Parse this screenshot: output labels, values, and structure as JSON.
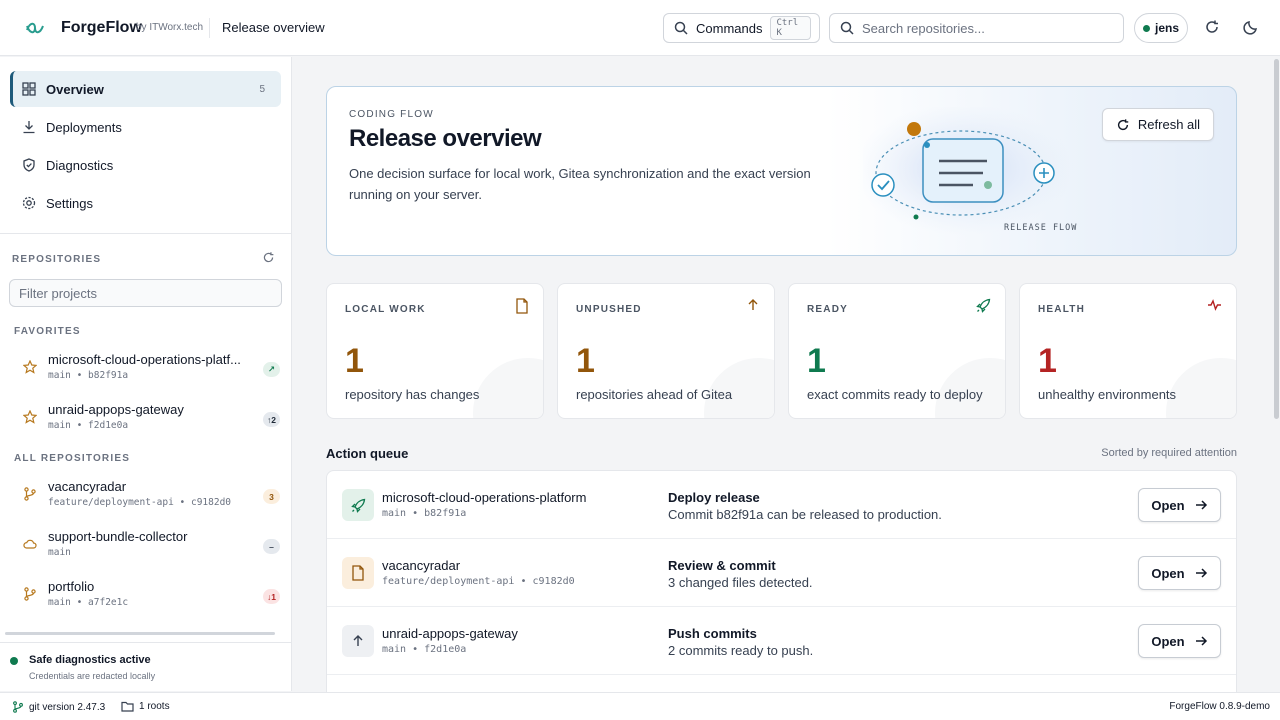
{
  "header": {
    "brand": "ForgeFlow",
    "brand_sub": "by ITWorx.tech",
    "page_title": "Release overview",
    "commands_label": "Commands",
    "commands_shortcut": "Ctrl K",
    "search_placeholder": "Search repositories...",
    "user": "jens"
  },
  "sidebar": {
    "nav": [
      {
        "label": "Overview",
        "count": "5",
        "icon": "grid-icon",
        "active": true
      },
      {
        "label": "Deployments",
        "icon": "download-icon"
      },
      {
        "label": "Diagnostics",
        "icon": "shield-check-icon"
      },
      {
        "label": "Settings",
        "icon": "gear-icon"
      }
    ],
    "repositories_label": "REPOSITORIES",
    "filter_placeholder": "Filter projects",
    "favorites_label": "FAVORITES",
    "favorites": [
      {
        "name": "microsoft-cloud-operations-platf...",
        "meta": "main • b82f91a",
        "badge": "↗",
        "icon": "star-icon"
      },
      {
        "name": "unraid-appops-gateway",
        "meta": "main • f2d1e0a",
        "badge": "↑2",
        "icon": "star-icon"
      }
    ],
    "all_label": "ALL REPOSITORIES",
    "all": [
      {
        "name": "vacancyradar",
        "meta": "feature/deployment-api • c9182d0",
        "badge": "3",
        "icon": "branch-icon"
      },
      {
        "name": "support-bundle-collector",
        "meta": "main",
        "badge": "–",
        "icon": "cloud-icon"
      },
      {
        "name": "portfolio",
        "meta": "main • a7f2e1c",
        "badge": "↓1",
        "icon": "branch-icon"
      }
    ],
    "safe_title": "Safe diagnostics active",
    "safe_sub": "Credentials are redacted locally"
  },
  "statusbar": {
    "git": "git version 2.47.3",
    "roots": "1 roots",
    "version": "ForgeFlow 0.8.9-demo"
  },
  "hero": {
    "eyebrow": "CODING FLOW",
    "title": "Release overview",
    "description": "One decision surface for local work, Gitea synchronization and the exact version running on your server.",
    "art_label": "RELEASE FLOW",
    "refresh_label": "Refresh all"
  },
  "stats": [
    {
      "label": "LOCAL WORK",
      "value": "1",
      "desc": "repository has changes",
      "color": "#92560b",
      "icon": "file-icon"
    },
    {
      "label": "UNPUSHED",
      "value": "1",
      "desc": "repositories ahead of Gitea",
      "color": "#92560b",
      "icon": "arrow-up-icon"
    },
    {
      "label": "READY",
      "value": "1",
      "desc": "exact commits ready to deploy",
      "color": "#0f7a4f",
      "icon": "rocket-icon"
    },
    {
      "label": "HEALTH",
      "value": "1",
      "desc": "unhealthy environments",
      "color": "#b42323",
      "icon": "pulse-icon"
    }
  ],
  "queue": {
    "title": "Action queue",
    "sort_label": "Sorted by required attention",
    "rows": [
      {
        "name": "microsoft-cloud-operations-platform",
        "meta": "main • b82f91a",
        "action": "Deploy release",
        "desc": "Commit b82f91a can be released to production.",
        "button": "Open",
        "icon": "rocket-icon"
      },
      {
        "name": "vacancyradar",
        "meta": "feature/deployment-api • c9182d0",
        "action": "Review & commit",
        "desc": "3 changed files detected.",
        "button": "Open",
        "icon": "file-icon"
      },
      {
        "name": "unraid-appops-gateway",
        "meta": "main • f2d1e0a",
        "action": "Push commits",
        "desc": "2 commits ready to push.",
        "button": "Open",
        "icon": "arrow-up-icon"
      }
    ]
  },
  "colors": {
    "accent": "#1e5a7a",
    "success": "#0f7a4f",
    "warning": "#92560b",
    "danger": "#b42323"
  }
}
